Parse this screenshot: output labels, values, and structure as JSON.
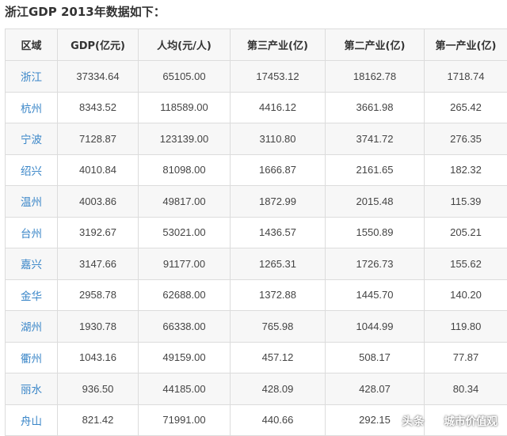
{
  "heading": "浙江GDP 2013年数据如下：",
  "table": {
    "headers": [
      "区域",
      "GDP(亿元)",
      "人均(元/人)",
      "第三产业(亿)",
      "第二产业(亿)",
      "第一产业(亿)"
    ],
    "rows": [
      {
        "region": "浙江",
        "gdp": "37334.64",
        "per_capita": "65105.00",
        "tertiary": "17453.12",
        "secondary": "18162.78",
        "primary": "1718.74"
      },
      {
        "region": "杭州",
        "gdp": "8343.52",
        "per_capita": "118589.00",
        "tertiary": "4416.12",
        "secondary": "3661.98",
        "primary": "265.42"
      },
      {
        "region": "宁波",
        "gdp": "7128.87",
        "per_capita": "123139.00",
        "tertiary": "3110.80",
        "secondary": "3741.72",
        "primary": "276.35"
      },
      {
        "region": "绍兴",
        "gdp": "4010.84",
        "per_capita": "81098.00",
        "tertiary": "1666.87",
        "secondary": "2161.65",
        "primary": "182.32"
      },
      {
        "region": "温州",
        "gdp": "4003.86",
        "per_capita": "49817.00",
        "tertiary": "1872.99",
        "secondary": "2015.48",
        "primary": "115.39"
      },
      {
        "region": "台州",
        "gdp": "3192.67",
        "per_capita": "53021.00",
        "tertiary": "1436.57",
        "secondary": "1550.89",
        "primary": "205.21"
      },
      {
        "region": "嘉兴",
        "gdp": "3147.66",
        "per_capita": "91177.00",
        "tertiary": "1265.31",
        "secondary": "1726.73",
        "primary": "155.62"
      },
      {
        "region": "金华",
        "gdp": "2958.78",
        "per_capita": "62688.00",
        "tertiary": "1372.88",
        "secondary": "1445.70",
        "primary": "140.20"
      },
      {
        "region": "湖州",
        "gdp": "1930.78",
        "per_capita": "66338.00",
        "tertiary": "765.98",
        "secondary": "1044.99",
        "primary": "119.80"
      },
      {
        "region": "衢州",
        "gdp": "1043.16",
        "per_capita": "49159.00",
        "tertiary": "457.12",
        "secondary": "508.17",
        "primary": "77.87"
      },
      {
        "region": "丽水",
        "gdp": "936.50",
        "per_capita": "44185.00",
        "tertiary": "428.09",
        "secondary": "428.07",
        "primary": "80.34"
      },
      {
        "region": "舟山",
        "gdp": "821.42",
        "per_capita": "71991.00",
        "tertiary": "440.66",
        "secondary": "292.15",
        "primary": ""
      }
    ]
  },
  "watermark": {
    "platform": "头条",
    "at_icon": "at-sign-icon",
    "author": "城市价值观"
  },
  "colors": {
    "region_link": "#3a86c8",
    "header_bg": "#f7f7f7",
    "border": "#dcdcdc"
  }
}
